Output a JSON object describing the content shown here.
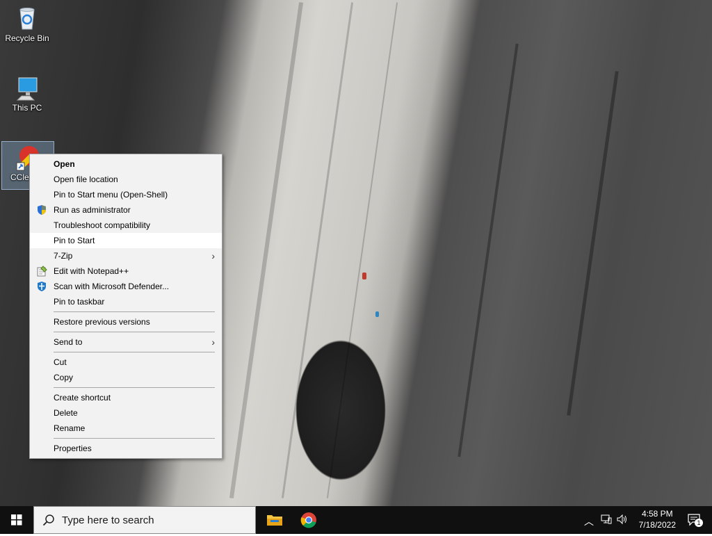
{
  "desktop": {
    "icons": [
      {
        "label": "Recycle Bin"
      },
      {
        "label": "This PC"
      },
      {
        "label": "CCle"
      }
    ]
  },
  "context_menu": {
    "items": [
      {
        "label": "Open"
      },
      {
        "label": "Open file location"
      },
      {
        "label": "Pin to Start menu (Open-Shell)"
      },
      {
        "label": "Run as administrator"
      },
      {
        "label": "Troubleshoot compatibility"
      },
      {
        "label": "Pin to Start"
      },
      {
        "label": "7-Zip"
      },
      {
        "label": "Edit with Notepad++"
      },
      {
        "label": "Scan with Microsoft Defender..."
      },
      {
        "label": "Pin to taskbar"
      },
      {
        "label": "Restore previous versions"
      },
      {
        "label": "Send to"
      },
      {
        "label": "Cut"
      },
      {
        "label": "Copy"
      },
      {
        "label": "Create shortcut"
      },
      {
        "label": "Delete"
      },
      {
        "label": "Rename"
      },
      {
        "label": "Properties"
      }
    ]
  },
  "taskbar": {
    "search_placeholder": "Type here to search",
    "time": "4:58 PM",
    "date": "7/18/2022",
    "notification_count": "1"
  },
  "colors": {
    "taskbar_bg": "#101010",
    "menu_bg": "#f2f2f2",
    "menu_hover": "#ffffff"
  }
}
